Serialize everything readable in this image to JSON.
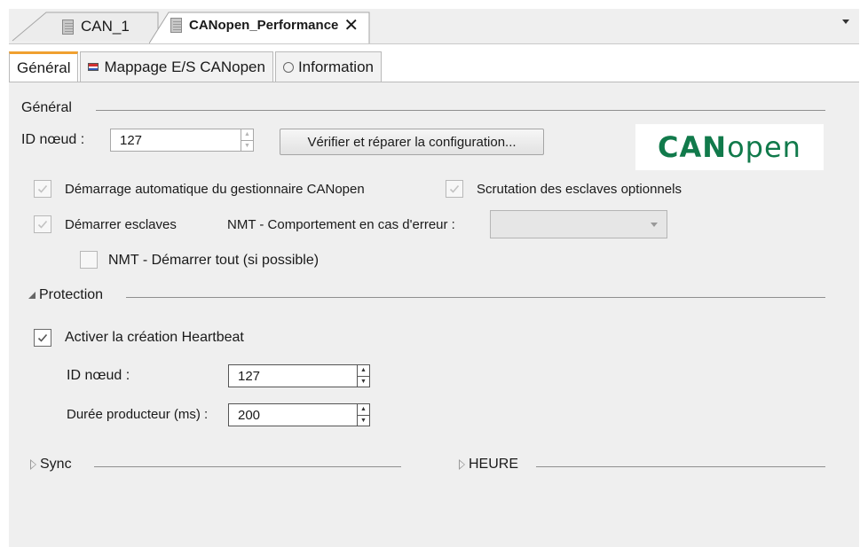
{
  "document_tabs": [
    {
      "label": "CAN_1"
    },
    {
      "label": "CANopen_Performance",
      "close": "✕"
    }
  ],
  "editor_tabs": [
    {
      "label": "Général"
    },
    {
      "label": "Mappage E/S CANopen"
    },
    {
      "label": "Information"
    }
  ],
  "general": {
    "title": "Général",
    "node_id_label": "ID nœud :",
    "node_id_value": "127",
    "verify_button": "Vérifier et réparer la configuration...",
    "auto_start_label": "Démarrage automatique du gestionnaire CANopen",
    "auto_start_checked": true,
    "poll_optional_label": "Scrutation des esclaves optionnels",
    "poll_optional_checked": true,
    "start_slaves_label": "Démarrer esclaves",
    "start_slaves_checked": true,
    "nmt_error_label": "NMT - Comportement en cas d'erreur :",
    "nmt_error_value": "",
    "nmt_start_all_label": "NMT - Démarrer tout (si possible)",
    "nmt_start_all_checked": false
  },
  "logo": {
    "bold": "CAN",
    "light": "open"
  },
  "protection": {
    "title": "Protection",
    "heartbeat_label": "Activer la création Heartbeat",
    "heartbeat_checked": true,
    "node_id_label": "ID nœud :",
    "node_id_value": "127",
    "producer_time_label": "Durée producteur (ms) :",
    "producer_time_value": "200"
  },
  "sync": {
    "title": "Sync"
  },
  "time": {
    "title": "HEURE"
  }
}
